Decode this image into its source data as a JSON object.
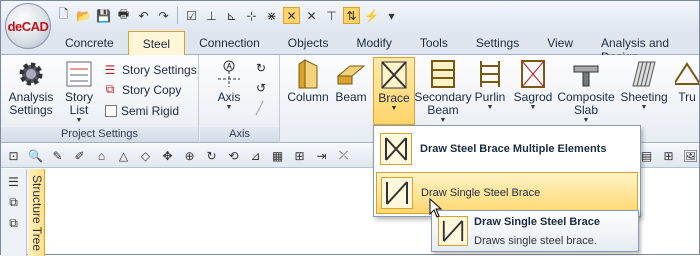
{
  "app": {
    "logo_text": "deCAD"
  },
  "quick_access": {
    "icons": [
      "new-file-icon",
      "open-folder-icon",
      "save-icon",
      "print-icon",
      "undo-icon",
      "redo-icon",
      "select-icon",
      "axis-tool-icon",
      "axis-tool-2-icon",
      "grid-icon",
      "snap-icon",
      "snap-2-icon",
      "snap-3-icon",
      "analysis-icon",
      "bolt-icon"
    ],
    "more_label": "▾"
  },
  "tabs": [
    {
      "label": "Concrete",
      "active": false
    },
    {
      "label": "Steel",
      "active": true
    },
    {
      "label": "Connection",
      "active": false
    },
    {
      "label": "Objects",
      "active": false
    },
    {
      "label": "Modify",
      "active": false
    },
    {
      "label": "Tools",
      "active": false
    },
    {
      "label": "Settings",
      "active": false
    },
    {
      "label": "View",
      "active": false
    },
    {
      "label": "Analysis and Design",
      "active": false
    }
  ],
  "ribbon": {
    "project_settings": {
      "label": "Project Settings",
      "analysis_settings": "Analysis Settings",
      "story_list": "Story List",
      "story_settings": "Story Settings",
      "story_copy": "Story Copy",
      "semi_rigid": "Semi Rigid"
    },
    "axis": {
      "label": "Axis",
      "axis_button": "Axis"
    },
    "steel": {
      "column": "Column",
      "beam": "Beam",
      "brace": "Brace",
      "secondary_beam": "Secondary Beam",
      "purlin": "Purlin",
      "sagrod": "Sagrod",
      "composite_slab": "Composite Slab",
      "sheeting": "Sheeting",
      "truss": "Tru"
    }
  },
  "side_panel": {
    "structure_tree": "Structure Tree"
  },
  "brace_menu": {
    "items": [
      {
        "label": "Draw Steel Brace Multiple Elements",
        "hover": false
      },
      {
        "label": "Draw Single Steel Brace",
        "hover": true
      }
    ]
  },
  "tooltip": {
    "title": "Draw Single Steel Brace",
    "description": "Draws single steel brace."
  }
}
